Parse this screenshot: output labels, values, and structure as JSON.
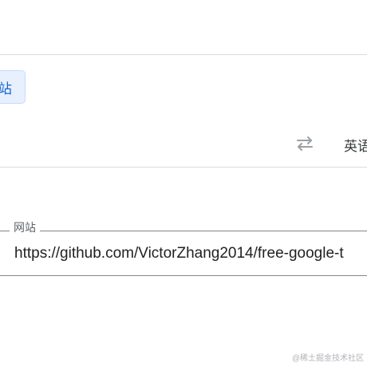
{
  "mode_tab": {
    "label": "站"
  },
  "language_bar": {
    "swap_icon": "swap-arrows-icon",
    "target_language": "英语"
  },
  "url_field": {
    "legend": "网站",
    "value": "https://github.com/VictorZhang2014/free-google-t"
  },
  "watermark": {
    "text": "@稀土掘金技术社区"
  },
  "colors": {
    "accent": "#1967d2",
    "accent_bg": "#e8f0fe",
    "divider": "#dadce0",
    "icon": "#9aa0a6"
  }
}
